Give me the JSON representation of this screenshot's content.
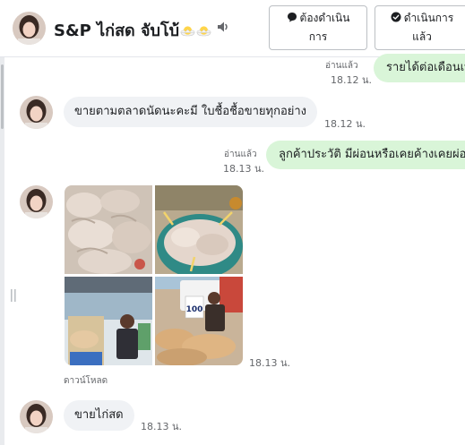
{
  "header": {
    "chat_name": "S&P ไก่สด จับโบ้",
    "need_action_label_1": "ต้องดำเนิน",
    "need_action_label_2": "การ",
    "done_label_1": "ดำเนินการ",
    "done_label_2": "แล้ว"
  },
  "messages": [
    {
      "direction": "out",
      "read_label": "อ่านแล้ว",
      "time": "18.12 น.",
      "text": "รายได้ต่อเดือนเท่าไหร่"
    },
    {
      "direction": "in",
      "time": "18.12 น.",
      "text": "ขายตามตลาดนัดนะคะมี ใบชื้อชื้อขายทุกอย่าง"
    },
    {
      "direction": "out",
      "read_label": "อ่านแล้ว",
      "time": "18.13 น.",
      "text": "ลูกค้าประวัติ มีผ่อนหรือเคยค้างเคยผ่อน"
    },
    {
      "direction": "in",
      "type": "photos",
      "time": "18.13 น.",
      "download_label": "ดาวน์โหลด",
      "sign_text": "100"
    },
    {
      "direction": "in",
      "time": "18.13 น.",
      "text": "ขายไก่สด"
    }
  ],
  "colors": {
    "outgoing_bubble": "#d9f5d8",
    "incoming_bubble": "#f0f2f5"
  }
}
